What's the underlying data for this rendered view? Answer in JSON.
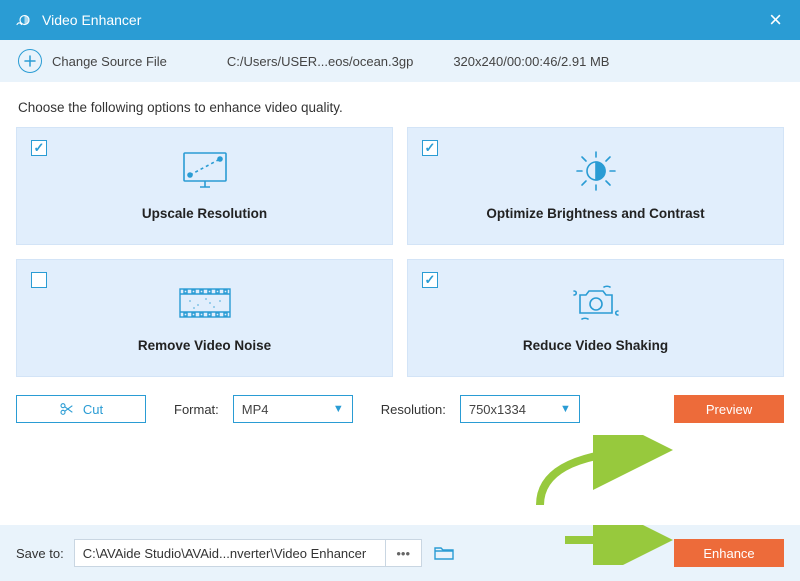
{
  "titlebar": {
    "title": "Video Enhancer"
  },
  "sourcebar": {
    "change_label": "Change Source File",
    "path": "C:/Users/USER...eos/ocean.3gp",
    "meta": "320x240/00:00:46/2.91 MB"
  },
  "instructions": "Choose the following options to enhance video quality.",
  "options": {
    "upscale": {
      "label": "Upscale Resolution",
      "checked": true
    },
    "brightness": {
      "label": "Optimize Brightness and Contrast",
      "checked": true
    },
    "noise": {
      "label": "Remove Video Noise",
      "checked": false
    },
    "shaking": {
      "label": "Reduce Video Shaking",
      "checked": true
    }
  },
  "controls": {
    "cut_label": "Cut",
    "format_label": "Format:",
    "format_value": "MP4",
    "resolution_label": "Resolution:",
    "resolution_value": "750x1334",
    "preview_label": "Preview"
  },
  "footer": {
    "save_label": "Save to:",
    "save_path": "C:\\AVAide Studio\\AVAid...nverter\\Video Enhancer",
    "enhance_label": "Enhance"
  },
  "colors": {
    "accent": "#2a9cd4",
    "card_bg": "#e1eefc",
    "orange": "#ed6b3a",
    "arrow": "#97c93d"
  }
}
